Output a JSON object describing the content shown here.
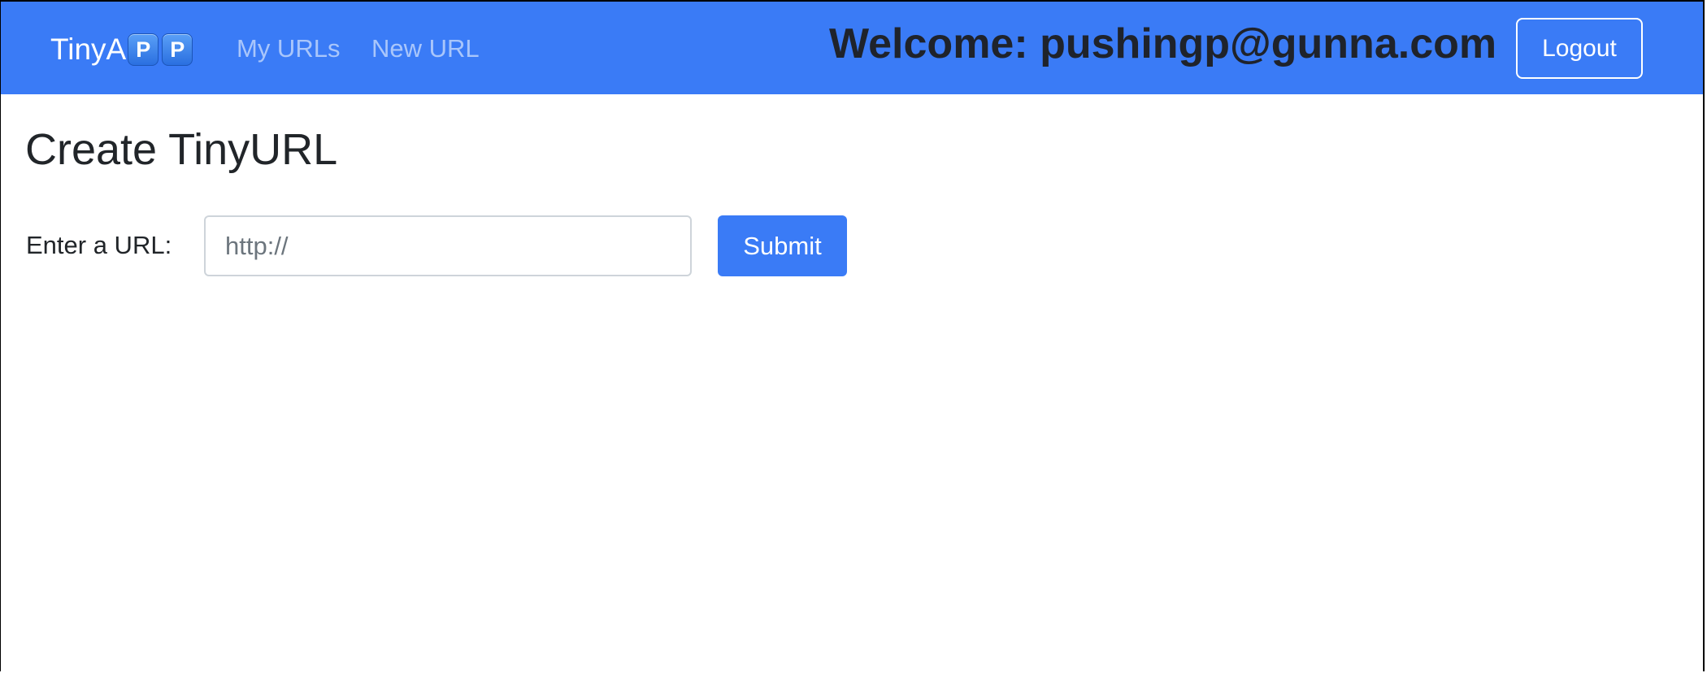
{
  "navbar": {
    "brand": {
      "text": "TinyA",
      "badges": [
        "P",
        "P"
      ]
    },
    "links": [
      {
        "label": "My URLs"
      },
      {
        "label": "New URL"
      }
    ],
    "welcome": "Welcome: pushingp@gunna.com",
    "logout_label": "Logout"
  },
  "main": {
    "title": "Create TinyURL",
    "form": {
      "url_label": "Enter a URL:",
      "url_value": "",
      "url_placeholder": "http://",
      "submit_label": "Submit"
    }
  },
  "colors": {
    "navbar_bg": "#3a7bf6",
    "nav_link": "#a9c6fb",
    "primary_button": "#3a7bf6",
    "text": "#212529"
  }
}
